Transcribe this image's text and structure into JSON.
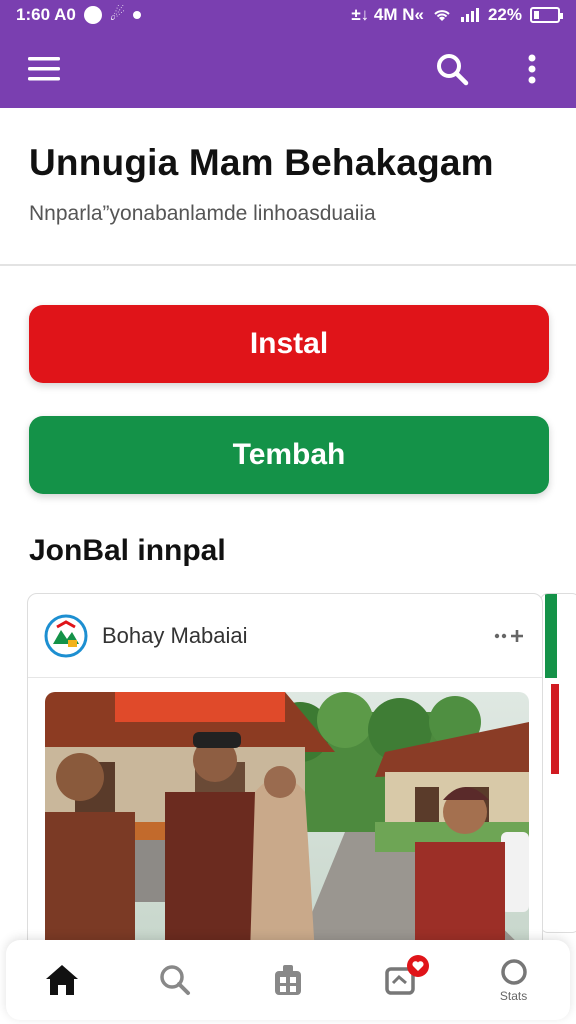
{
  "status_bar": {
    "time": "1:60 A0",
    "left_extra": "☄",
    "network": "±↓ 4M N«",
    "battery_text": "22%",
    "battery_level": 0.22
  },
  "app_bar": {
    "icons": [
      "menu-icon",
      "search-icon",
      "more-vert-icon"
    ]
  },
  "header": {
    "title": "Unnugia Mam Behakagam",
    "subtitle": "Nnparla”yonabanlamde linhoasduaiia"
  },
  "actions": {
    "install_label": "Instal",
    "add_label": "Tembah",
    "install_color": "#e01419",
    "add_color": "#149248"
  },
  "section": {
    "title": "JonBal innpal"
  },
  "card": {
    "name": "Bohay Mabaiai",
    "action_icon": "more-add-icon"
  },
  "bottom_nav": {
    "items": [
      {
        "icon": "home-icon",
        "label": ""
      },
      {
        "icon": "search-icon",
        "label": ""
      },
      {
        "icon": "apps-icon",
        "label": ""
      },
      {
        "icon": "inbox-icon",
        "label": ""
      },
      {
        "icon": "profile-icon",
        "label": "Stats"
      }
    ]
  },
  "colors": {
    "brand": "#7a3fb0",
    "install": "#e01419",
    "add": "#149248"
  }
}
